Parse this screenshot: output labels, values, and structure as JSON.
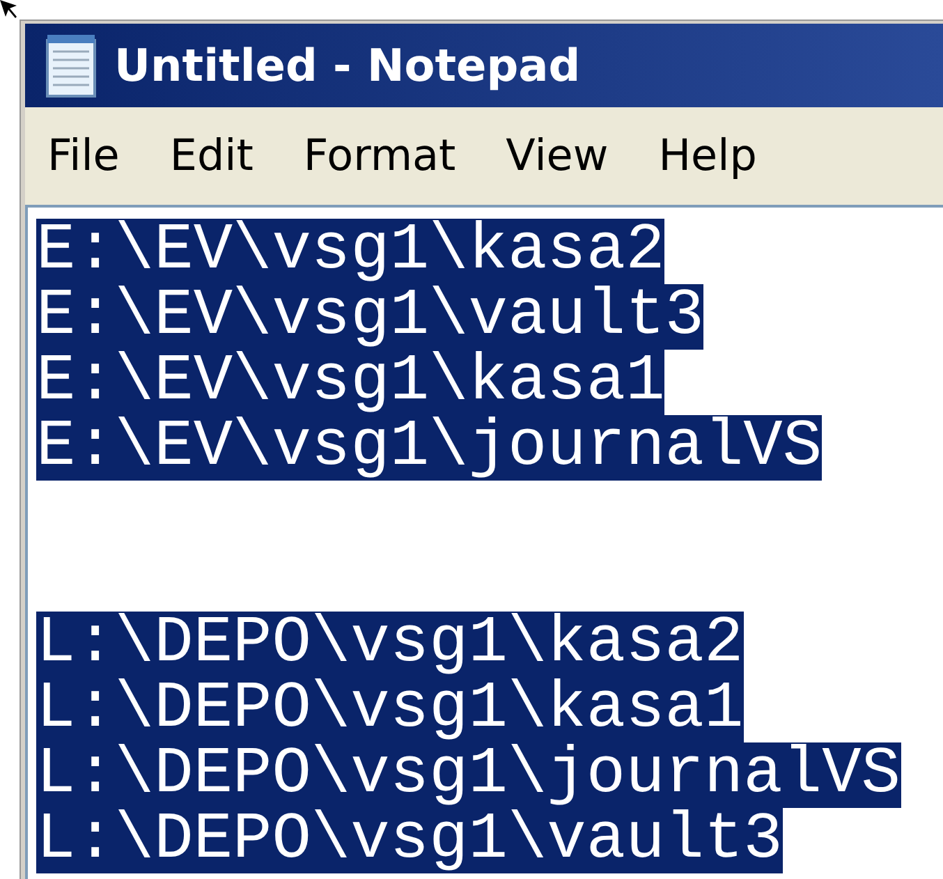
{
  "window": {
    "title": "Untitled - Notepad"
  },
  "menu": [
    {
      "label": "File"
    },
    {
      "label": "Edit"
    },
    {
      "label": "Format"
    },
    {
      "label": "View"
    },
    {
      "label": "Help"
    }
  ],
  "paragraphs": [
    {
      "lines": [
        {
          "text": "E:\\EV\\vsg1\\kasa2",
          "selected": true
        },
        {
          "text": "E:\\EV\\vsg1\\vault3",
          "selected": true
        },
        {
          "text": "E:\\EV\\vsg1\\kasa1",
          "selected": true
        },
        {
          "text": "E:\\EV\\vsg1\\journalVS",
          "selected": true
        }
      ]
    },
    {
      "lines": [
        {
          "text": "L:\\DEPO\\vsg1\\kasa2",
          "selected": true
        },
        {
          "text": "L:\\DEPO\\vsg1\\kasa1",
          "selected": true
        },
        {
          "text": "L:\\DEPO\\vsg1\\journalVS",
          "selected": true
        },
        {
          "text": "L:\\DEPO\\vsg1\\vault3",
          "selected": true
        }
      ]
    }
  ]
}
